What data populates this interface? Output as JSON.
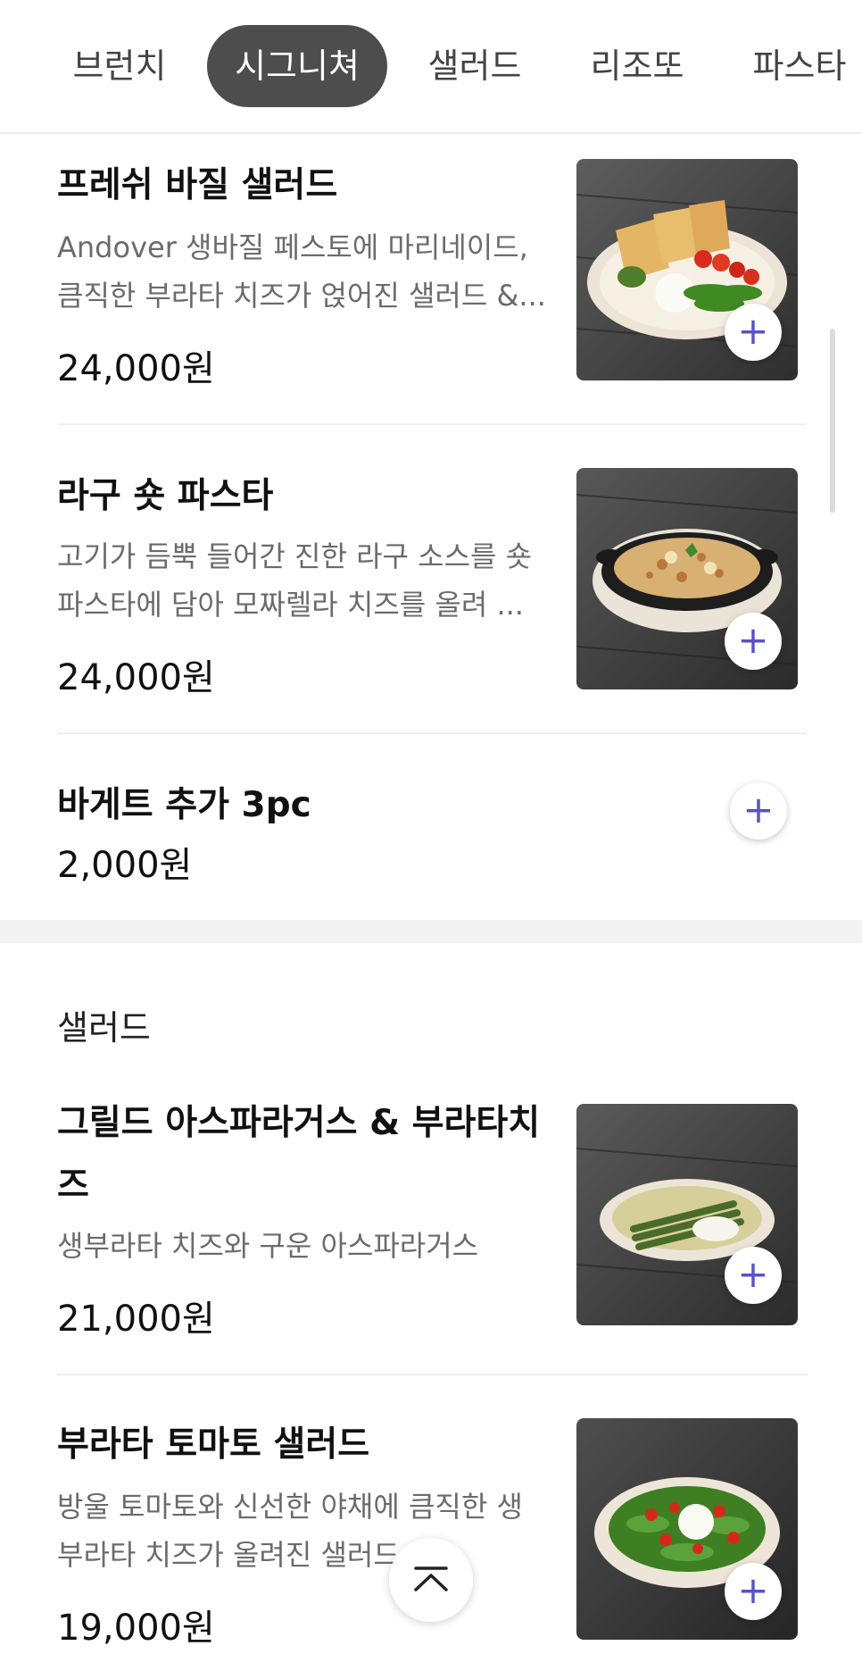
{
  "tabs": [
    {
      "label": "브런치",
      "active": false
    },
    {
      "label": "시그니쳐",
      "active": true
    },
    {
      "label": "샐러드",
      "active": false
    },
    {
      "label": "리조또",
      "active": false
    },
    {
      "label": "파스타",
      "active": false
    }
  ],
  "items": [
    {
      "title": "프레쉬 바질 샐러드",
      "desc_lines": [
        "Andover 생바질 페스토에 마리네이드,",
        "큼직한 부라타 치즈가 얹어진 샐러드 &..."
      ],
      "price": "24,000원",
      "image_icon": "salad-toast-plate"
    },
    {
      "title": "라구 숏 파스타",
      "desc_lines": [
        "고기가 듬뿍 들어간 진한 라구 소스를 숏",
        "파스타에 담아 모짜렐라 치즈를 올려 ..."
      ],
      "price": "24,000원",
      "image_icon": "baked-pasta-dish"
    },
    {
      "title": "바게트 추가 3pc",
      "price": "2,000원"
    }
  ],
  "salad_section": {
    "title": "샐러드",
    "items": [
      {
        "title_lines": [
          "그릴드 아스파라거스 & 부라타치",
          "즈"
        ],
        "desc": "생부라타 치즈와 구운 아스파라거스",
        "price": "21,000원",
        "image_icon": "asparagus-plate"
      },
      {
        "title": "부라타 토마토 샐러드",
        "desc_lines": [
          "방울 토마토와 신선한 야채에 큼직한 생",
          "부라타 치즈가 올려진 샐러드"
        ],
        "price": "19,000원",
        "image_icon": "tomato-salad-plate"
      }
    ]
  },
  "add_symbol": "+",
  "colors": {
    "accent": "#5a52c8",
    "active_tab": "#4d4d4d",
    "desc_text": "#6b6b6b"
  }
}
